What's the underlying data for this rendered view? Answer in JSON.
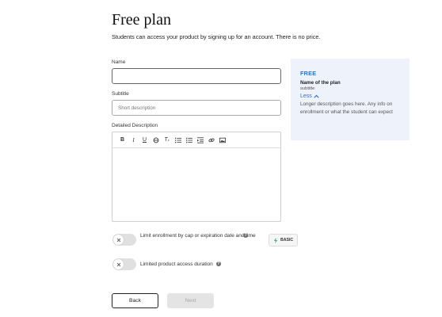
{
  "header": {
    "title": "Free plan",
    "subtitle": "Students can access your product by signing up for an account. There is no price."
  },
  "form": {
    "name_label": "Name",
    "name_value": "",
    "subtitle_label": "Subtitle",
    "subtitle_placeholder": "Short description",
    "description_label": "Detailed Description",
    "toolbar_icons": [
      "bold-icon",
      "italic-icon",
      "underline-icon",
      "strikethrough-icon",
      "clear-format-icon",
      "ordered-list-icon",
      "bullet-list-icon",
      "indent-icon",
      "link-icon",
      "image-icon"
    ]
  },
  "preview": {
    "tag": "FREE",
    "name": "Name of the plan",
    "subtitle": "subtitle",
    "toggle_label": "Less",
    "description": "Longer description goes here. Any info on enrollment or what the student can expect"
  },
  "options": {
    "limit_enrollment": {
      "label": "Limit enrollment by cap or expiration date and time",
      "enabled": false
    },
    "badge": "BASIC",
    "limit_access": {
      "label": "Limited product access duration",
      "enabled": false
    }
  },
  "footer": {
    "back_label": "Back",
    "next_label": "Next"
  },
  "colors": {
    "accent": "#3a6fb5",
    "preview_bg": "#eef2fb",
    "badge_icon": "#2bb673"
  }
}
